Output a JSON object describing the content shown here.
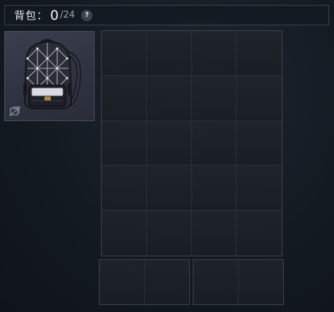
{
  "backpack": {
    "label": "背包",
    "separator": "：",
    "used": "0",
    "slash": "/",
    "capacity": "24",
    "help_glyph": "?"
  },
  "equipped_item": {
    "icon": "backpack-icon",
    "status_icon": "unbind-icon"
  },
  "main_grid": {
    "columns": 4,
    "rows": 5
  },
  "extra_grids": [
    {
      "columns": 2,
      "rows": 1
    },
    {
      "columns": 2,
      "rows": 1
    }
  ],
  "colors": {
    "background": "#141a22",
    "panel_border": "#3d444e",
    "item_bg": "#2f3240",
    "text": "#e6e8ec"
  }
}
